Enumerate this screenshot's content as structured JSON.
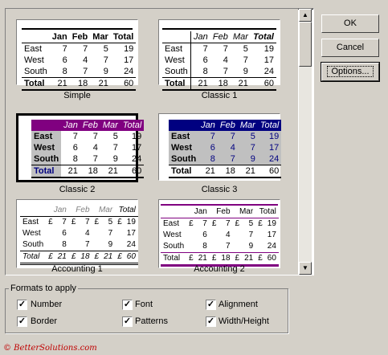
{
  "gallery": {
    "samples": [
      {
        "name": "Simple",
        "header": [
          "",
          "Jan",
          "Feb",
          "Mar",
          "Total"
        ],
        "rows": [
          [
            "East",
            "7",
            "7",
            "5",
            "19"
          ],
          [
            "West",
            "6",
            "4",
            "7",
            "17"
          ],
          [
            "South",
            "8",
            "7",
            "9",
            "24"
          ],
          [
            "Total",
            "21",
            "18",
            "21",
            "60"
          ]
        ]
      },
      {
        "name": "Classic 1",
        "header": [
          "",
          "Jan",
          "Feb",
          "Mar",
          "Total"
        ],
        "rows": [
          [
            "East",
            "7",
            "7",
            "5",
            "19"
          ],
          [
            "West",
            "6",
            "4",
            "7",
            "17"
          ],
          [
            "South",
            "8",
            "7",
            "9",
            "24"
          ],
          [
            "Total",
            "21",
            "18",
            "21",
            "60"
          ]
        ]
      },
      {
        "name": "Classic 2",
        "header": [
          "",
          "Jan",
          "Feb",
          "Mar",
          "Total"
        ],
        "rows": [
          [
            "East",
            "7",
            "7",
            "5",
            "19"
          ],
          [
            "West",
            "6",
            "4",
            "7",
            "17"
          ],
          [
            "South",
            "8",
            "7",
            "9",
            "24"
          ],
          [
            "Total",
            "21",
            "18",
            "21",
            "60"
          ]
        ]
      },
      {
        "name": "Classic 3",
        "header": [
          "",
          "Jan",
          "Feb",
          "Mar",
          "Total"
        ],
        "rows": [
          [
            "East",
            "7",
            "7",
            "5",
            "19"
          ],
          [
            "West",
            "6",
            "4",
            "7",
            "17"
          ],
          [
            "South",
            "8",
            "7",
            "9",
            "24"
          ],
          [
            "Total",
            "21",
            "18",
            "21",
            "60"
          ]
        ]
      },
      {
        "name": "Accounting 1",
        "header": [
          "",
          "Jan",
          "Feb",
          "Mar",
          "Total"
        ],
        "rows": [
          [
            "East",
            "£",
            "7",
            "£",
            "7",
            "£",
            "5",
            "£",
            "19"
          ],
          [
            "West",
            "",
            "6",
            "",
            "4",
            "",
            "7",
            "",
            "17"
          ],
          [
            "South",
            "",
            "8",
            "",
            "7",
            "",
            "9",
            "",
            "24"
          ],
          [
            "Total",
            "£",
            "21",
            "£",
            "18",
            "£",
            "21",
            "£",
            "60"
          ]
        ]
      },
      {
        "name": "Accounting 2",
        "header": [
          "",
          "Jan",
          "Feb",
          "Mar",
          "Total"
        ],
        "rows": [
          [
            "East",
            "£",
            "7",
            "£",
            "7",
            "£",
            "5",
            "£",
            "19"
          ],
          [
            "West",
            "",
            "6",
            "",
            "4",
            "",
            "7",
            "",
            "17"
          ],
          [
            "South",
            "",
            "8",
            "",
            "7",
            "",
            "9",
            "",
            "24"
          ],
          [
            "Total",
            "£",
            "21",
            "£",
            "18",
            "£",
            "21",
            "£",
            "60"
          ]
        ]
      }
    ],
    "selected": "Classic 2"
  },
  "buttons": {
    "ok": "OK",
    "cancel": "Cancel",
    "options": "Options..."
  },
  "formats": {
    "legend": "Formats to apply",
    "number": "Number",
    "font": "Font",
    "alignment": "Alignment",
    "border": "Border",
    "patterns": "Patterns",
    "width_height": "Width/Height",
    "check_mark": "✓"
  },
  "copyright": "© BetterSolutions.com",
  "colors": {
    "classic2_header": "#800080",
    "classic2_label": "#c0c0c0",
    "classic3_header": "#000080",
    "classic3_body": "#c0c0c0",
    "classic3_text": "#000080",
    "accounting2_rule": "#800080"
  }
}
